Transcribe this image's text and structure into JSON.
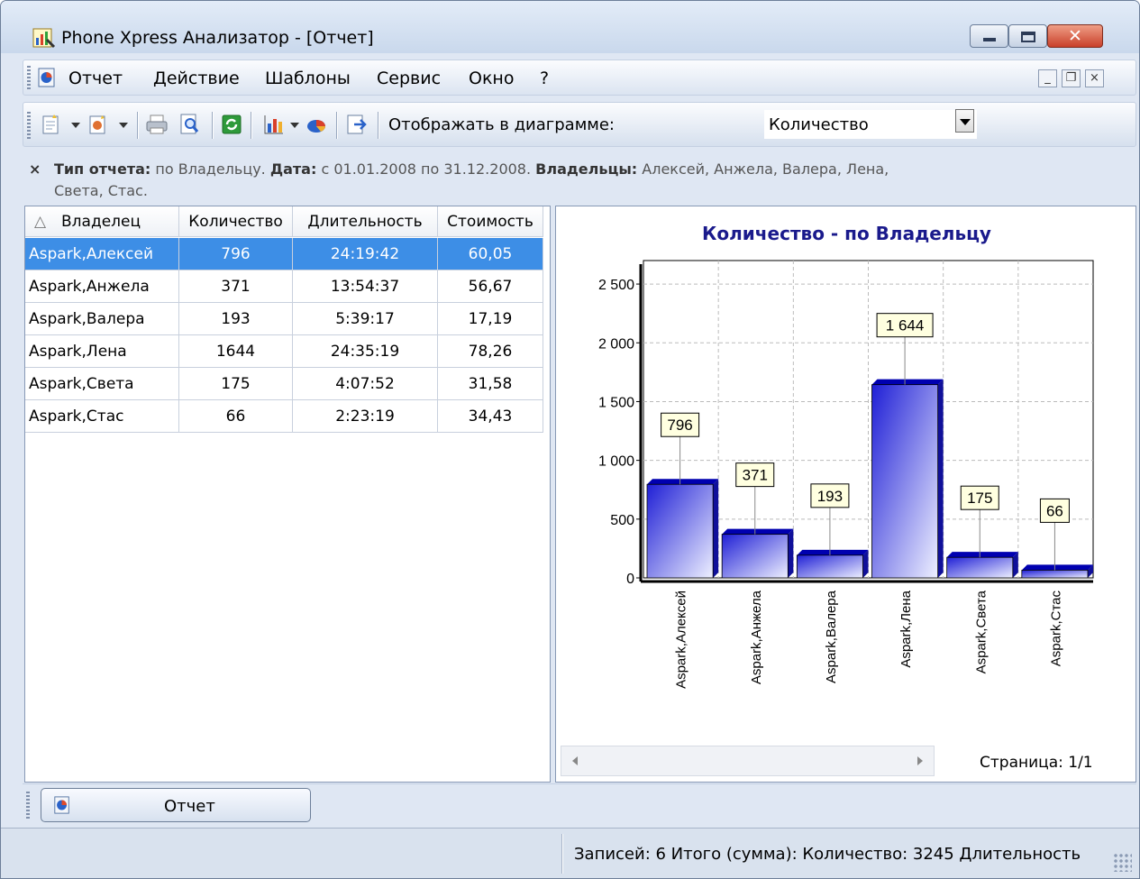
{
  "window": {
    "title": "Phone Xpress Анализатор - [Отчет]"
  },
  "menu": {
    "items": [
      "Отчет",
      "Действие",
      "Шаблоны",
      "Сервис",
      "Окно",
      "?"
    ],
    "mdi_min": "_",
    "mdi_restore": "❐",
    "mdi_close": "×"
  },
  "toolbar": {
    "display_label": "Отображать в диаграмме:",
    "display_value": "Количество"
  },
  "filter": {
    "close": "×",
    "type_label": "Тип отчета:",
    "type_value": " по Владельцу. ",
    "date_label": "Дата:",
    "date_value": " с 01.01.2008 по 31.12.2008. ",
    "owners_label": "Владельцы:",
    "owners_value": " Алексей, Анжела, Валера, Лена,",
    "owners_cont": "Света, Стас."
  },
  "grid": {
    "sort_glyph": "△",
    "columns": [
      "Владелец",
      "Количество",
      "Длительность",
      "Стоимость"
    ],
    "rows": [
      [
        "Aspark,Алексей",
        "796",
        "24:19:42",
        "60,05"
      ],
      [
        "Aspark,Анжела",
        "371",
        "13:54:37",
        "56,67"
      ],
      [
        "Aspark,Валера",
        "193",
        "5:39:17",
        "17,19"
      ],
      [
        "Aspark,Лена",
        "1644",
        "24:35:19",
        "78,26"
      ],
      [
        "Aspark,Света",
        "175",
        "4:07:52",
        "31,58"
      ],
      [
        "Aspark,Стас",
        "66",
        "2:23:19",
        "34,43"
      ]
    ]
  },
  "chart_data": {
    "type": "bar",
    "title": "Количество - по Владельцу",
    "categories": [
      "Aspark,Алексей",
      "Aspark,Анжела",
      "Aspark,Валера",
      "Aspark,Лена",
      "Aspark,Света",
      "Aspark,Стас"
    ],
    "values": [
      796,
      371,
      193,
      1644,
      175,
      66
    ],
    "data_labels": [
      "796",
      "371",
      "193",
      "1 644",
      "175",
      "66"
    ],
    "yticks": [
      0,
      500,
      1000,
      1500,
      2000,
      2500
    ],
    "ytick_labels": [
      "0",
      "500",
      "1 000",
      "1 500",
      "2 000",
      "2 500"
    ],
    "ylim": [
      0,
      2700
    ],
    "grid": true,
    "legend": "none",
    "bar_color": "#1f1fd6",
    "title_color": "#1a1a8c"
  },
  "chart_footer": {
    "page": "Страница: 1/1"
  },
  "doc_tabs": {
    "report": "Отчет"
  },
  "status": {
    "text": "Записей: 6  Итого (сумма):  Количество: 3245  Длительность"
  },
  "icons": [
    "app-chart-icon",
    "doc-report-icon",
    "new-report-icon",
    "open-report-icon",
    "print-icon",
    "preview-icon",
    "refresh-icon",
    "bar-chart-icon",
    "pie-chart-icon",
    "export-icon"
  ]
}
